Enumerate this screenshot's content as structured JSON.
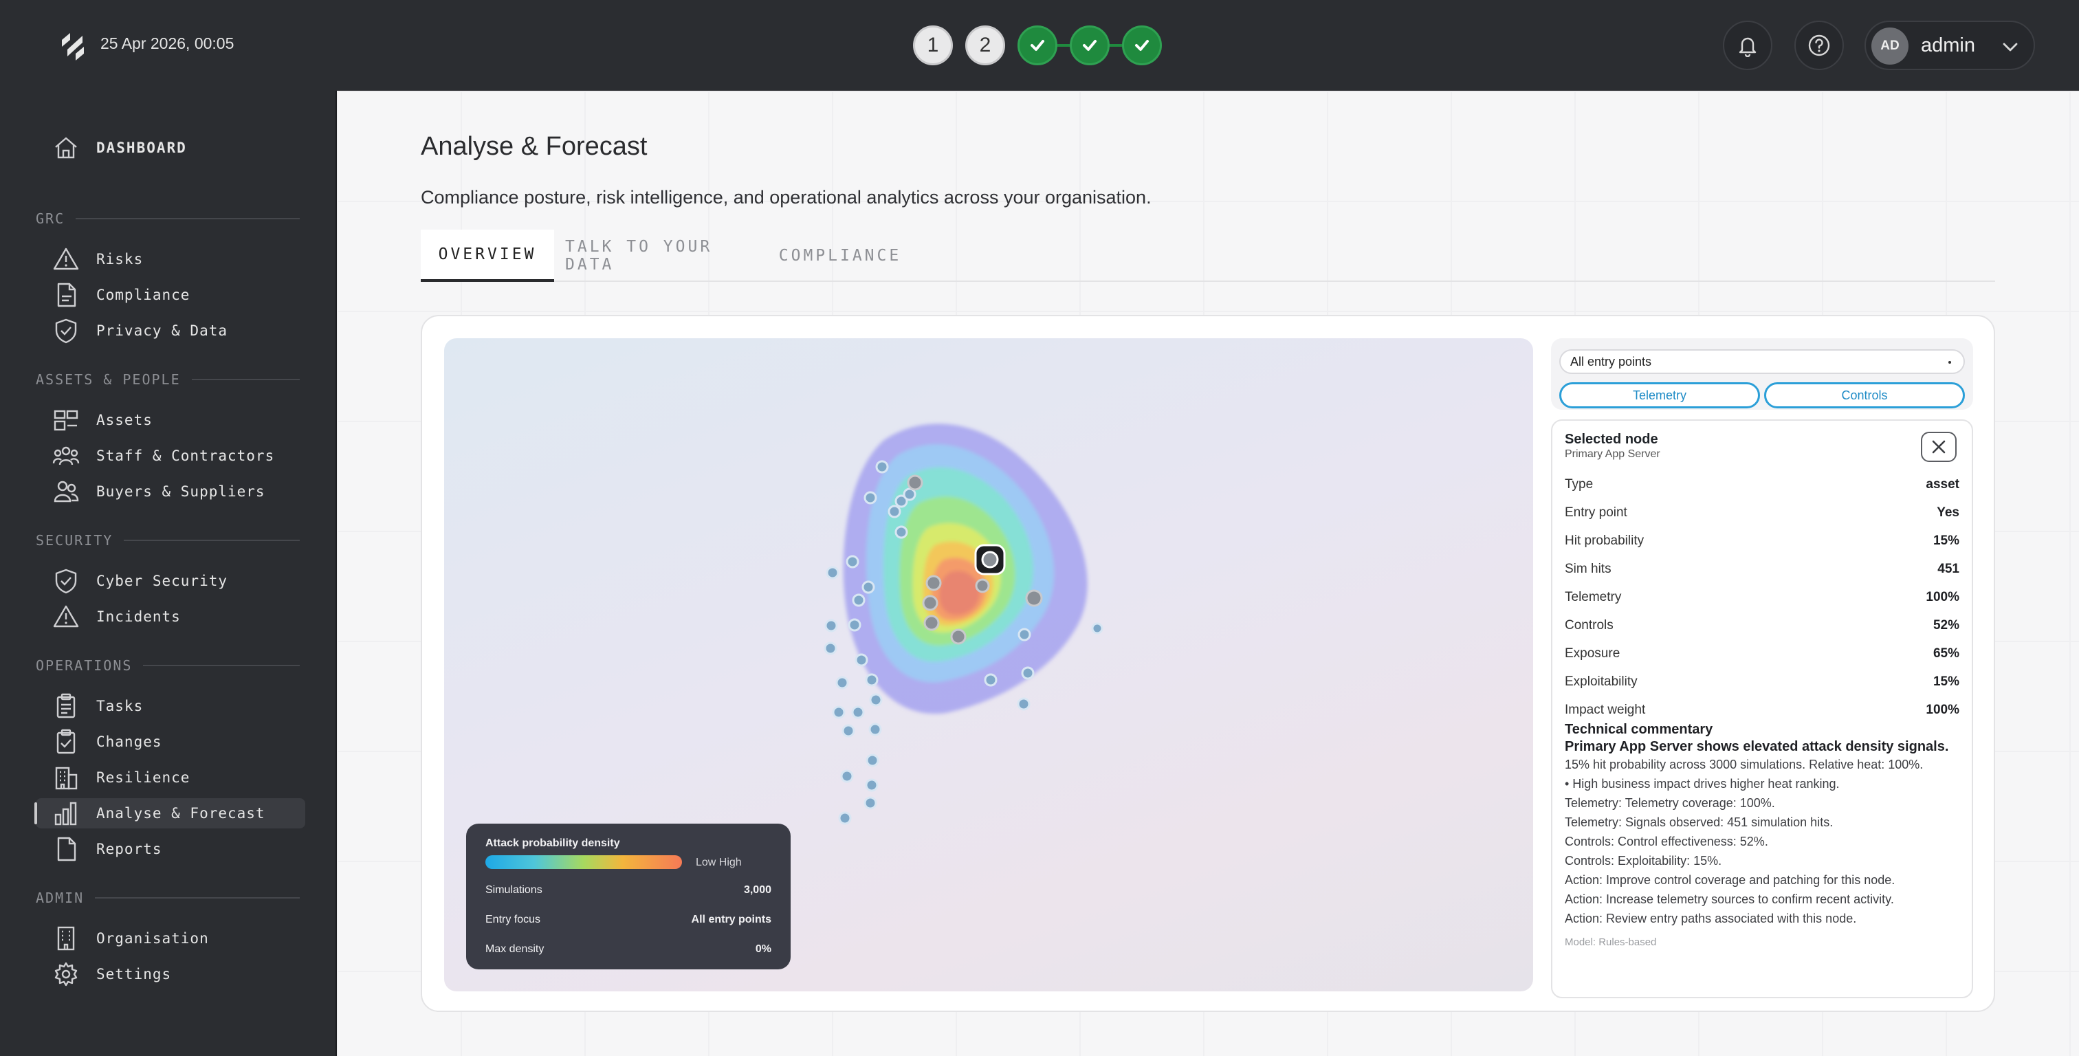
{
  "header": {
    "datetime": "25 Apr 2026, 00:05",
    "steps": [
      {
        "label": "1",
        "state": "number"
      },
      {
        "label": "2",
        "state": "number"
      },
      {
        "label": "",
        "state": "done"
      },
      {
        "label": "",
        "state": "done"
      },
      {
        "label": "",
        "state": "done"
      }
    ],
    "user": {
      "initials": "AD",
      "name": "admin"
    }
  },
  "sidebar": {
    "dashboard": "DASHBOARD",
    "sections": [
      {
        "title": "GRC",
        "items": [
          "Risks",
          "Compliance",
          "Privacy & Data"
        ]
      },
      {
        "title": "ASSETS & PEOPLE",
        "items": [
          "Assets",
          "Staff & Contractors",
          "Buyers & Suppliers"
        ]
      },
      {
        "title": "SECURITY",
        "items": [
          "Cyber Security",
          "Incidents"
        ]
      },
      {
        "title": "OPERATIONS",
        "items": [
          "Tasks",
          "Changes",
          "Resilience",
          "Analyse & Forecast",
          "Reports"
        ]
      },
      {
        "title": "ADMIN",
        "items": [
          "Organisation",
          "Settings"
        ]
      }
    ],
    "active_item": "Analyse & Forecast"
  },
  "page": {
    "title": "Analyse & Forecast",
    "subtitle": "Compliance posture, risk intelligence, and operational analytics across your organisation.",
    "tabs": [
      "OVERVIEW",
      "TALK TO YOUR DATA",
      "COMPLIANCE"
    ],
    "active_tab": "OVERVIEW"
  },
  "legend": {
    "title": "Attack probability density",
    "scale_label": "Low High",
    "simulations_label": "Simulations",
    "simulations_value": "3,000",
    "entry_focus_label": "Entry focus",
    "entry_focus_value": "All entry points",
    "max_density_label": "Max density",
    "max_density_value": "0%"
  },
  "controls": {
    "entry_select": "All entry points",
    "telemetry_btn": "Telemetry",
    "controls_btn": "Controls"
  },
  "node": {
    "heading": "Selected node",
    "name": "Primary App Server",
    "fields": [
      {
        "label": "Type",
        "value": "asset"
      },
      {
        "label": "Entry point",
        "value": "Yes"
      },
      {
        "label": "Hit probability",
        "value": "15%"
      },
      {
        "label": "Sim hits",
        "value": "451"
      },
      {
        "label": "Telemetry",
        "value": "100%"
      },
      {
        "label": "Controls",
        "value": "52%"
      },
      {
        "label": "Exposure",
        "value": "65%"
      },
      {
        "label": "Exploitability",
        "value": "15%"
      },
      {
        "label": "Impact weight",
        "value": "100%"
      }
    ],
    "commentary_title": "Technical commentary",
    "commentary_summary": "Primary App Server shows elevated attack density signals.",
    "commentary_lines": [
      "15% hit probability across 3000 simulations. Relative heat: 100%.",
      "• High business impact drives higher heat ranking.",
      "Telemetry: Telemetry coverage: 100%.",
      "Telemetry: Signals observed: 451 simulation hits.",
      "Controls: Control effectiveness: 52%.",
      "Controls: Exploitability: 15%.",
      "Action: Improve control coverage and patching for this node.",
      "Action: Increase telemetry sources to confirm recent activity.",
      "Action: Review entry paths associated with this node."
    ],
    "model": "Model: Rules-based"
  },
  "colors": {
    "step_done": "#1f8a3e",
    "pill_accent": "#2b9fd8",
    "sidebar_bg": "#2b2d31"
  }
}
